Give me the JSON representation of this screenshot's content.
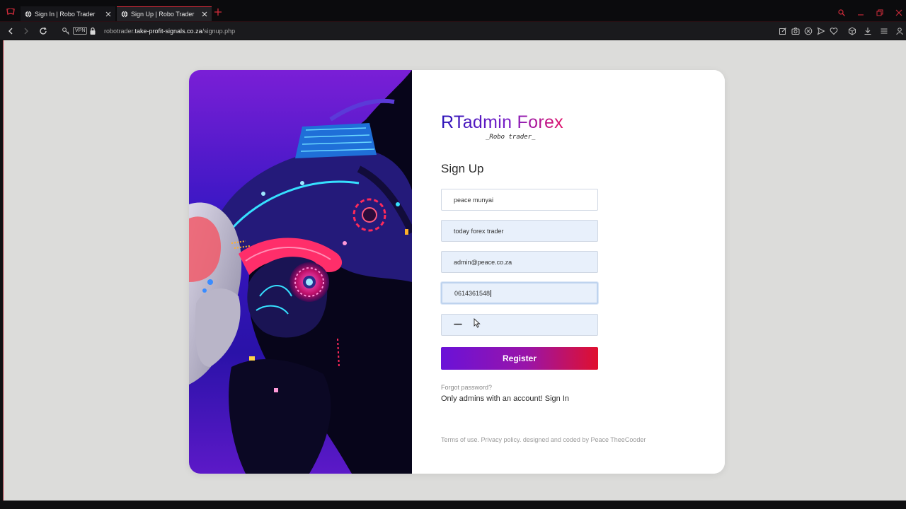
{
  "tabs": [
    {
      "label": "Sign In | Robo Trader",
      "active": false
    },
    {
      "label": "Sign Up | Robo Trader",
      "active": true
    }
  ],
  "address": {
    "vpn_label": "VPN",
    "url_prefix": "robotrader.",
    "url_domain": "take-profit-signals.co.za",
    "url_path": "/signup.php"
  },
  "brand": {
    "title": "RTadmin Forex",
    "tagline": "_Robo trader_"
  },
  "form": {
    "heading": "Sign Up",
    "fields": [
      {
        "value": "peace munyai"
      },
      {
        "value": "today forex trader"
      },
      {
        "value": "admin@peace.co.za"
      },
      {
        "value": "0614361548"
      },
      {
        "value": "••••••••••"
      }
    ],
    "register_label": "Register",
    "forgot_label": "Forgot password?",
    "signin_prefix": "Only admins with an account!",
    "signin_link": "Sign In",
    "footer": "Terms of use. Privacy policy. designed and coded by Peace TheeCooder"
  },
  "colors": {
    "accent": "#d12c3b",
    "brand_start": "#2a12b8",
    "brand_end": "#e0126a",
    "button_start": "#6a12d8",
    "button_end": "#e0102e"
  }
}
